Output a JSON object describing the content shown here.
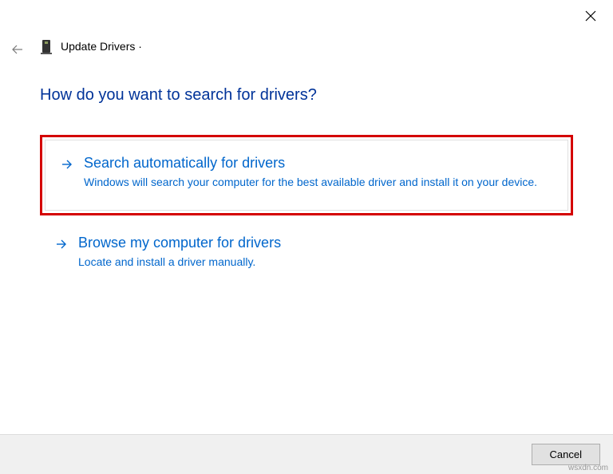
{
  "header": {
    "title": "Update Drivers ·"
  },
  "question": "How do you want to search for drivers?",
  "options": [
    {
      "title": "Search automatically for drivers",
      "desc": "Windows will search your computer for the best available driver and install it on your device."
    },
    {
      "title": "Browse my computer for drivers",
      "desc": "Locate and install a driver manually."
    }
  ],
  "footer": {
    "cancel": "Cancel"
  },
  "watermark": "wsxdn.com"
}
